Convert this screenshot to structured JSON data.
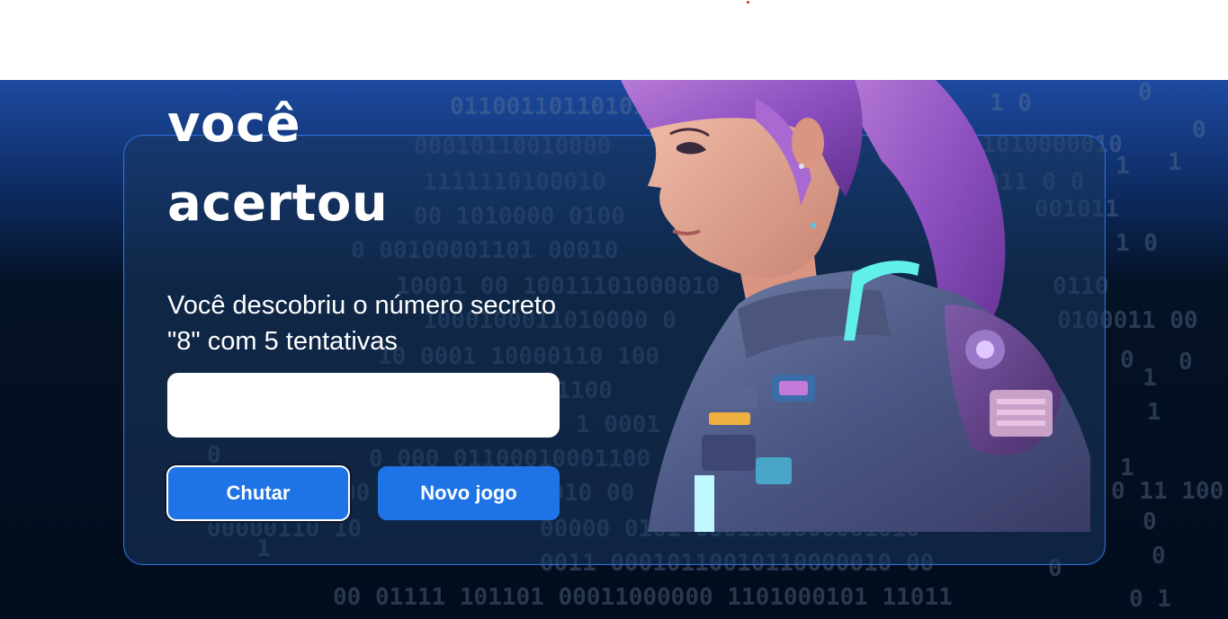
{
  "title": {
    "line1": "você",
    "line2": "acertou"
  },
  "message": "Você descobriu o número secreto \"8\" com 5 tentativas",
  "guess_input": {
    "value": "",
    "placeholder": ""
  },
  "buttons": {
    "guess": "Chutar",
    "new_game": "Novo jogo"
  },
  "colors": {
    "accent": "#1e74e6",
    "background_top": "#1d4aa0",
    "background_bottom": "#020c1c",
    "card_border": "#2e6ed6"
  },
  "images": {
    "portrait": "sci-fi-woman-illustration"
  }
}
